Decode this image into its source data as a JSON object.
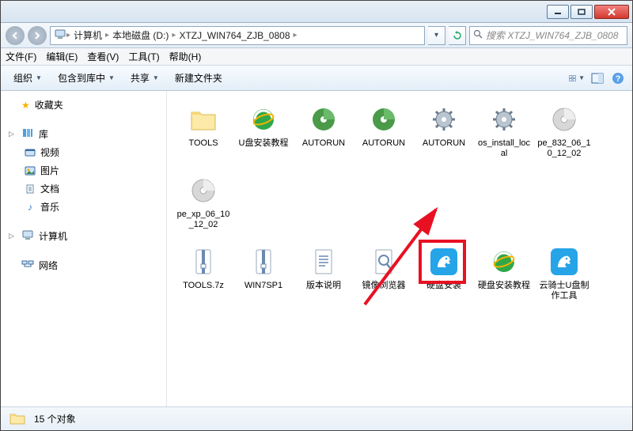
{
  "breadcrumb": {
    "root_icon": "computer-icon",
    "segments": [
      "计算机",
      "本地磁盘 (D:)",
      "XTZJ_WIN764_ZJB_0808"
    ]
  },
  "search": {
    "placeholder": "搜索 XTZJ_WIN764_ZJB_0808"
  },
  "menubar": {
    "file": "文件(F)",
    "edit": "编辑(E)",
    "view": "查看(V)",
    "tools": "工具(T)",
    "help": "帮助(H)"
  },
  "toolbar": {
    "organize": "组织",
    "include": "包含到库中",
    "share": "共享",
    "new_folder": "新建文件夹"
  },
  "sidebar": {
    "favorites": {
      "label": "收藏夹"
    },
    "libraries": {
      "label": "库",
      "items": [
        "视频",
        "图片",
        "文档",
        "音乐"
      ]
    },
    "computer": {
      "label": "计算机"
    },
    "network": {
      "label": "网络"
    }
  },
  "files": {
    "row1": [
      {
        "name": "TOOLS",
        "icon": "folder"
      },
      {
        "name": "U盘安装教程",
        "icon": "ie"
      },
      {
        "name": "AUTORUN",
        "icon": "disc-green"
      },
      {
        "name": "AUTORUN",
        "icon": "disc-green"
      },
      {
        "name": "AUTORUN",
        "icon": "gear"
      },
      {
        "name": "os_install_local",
        "icon": "gear"
      },
      {
        "name": "pe_832_06_10_12_02",
        "icon": "disc-grey"
      },
      {
        "name": "pe_xp_06_10_12_02",
        "icon": "disc-grey"
      }
    ],
    "row2": [
      {
        "name": "TOOLS.7z",
        "icon": "archive"
      },
      {
        "name": "WIN7SP1",
        "icon": "archive"
      },
      {
        "name": "版本说明",
        "icon": "text"
      },
      {
        "name": "镜像浏览器",
        "icon": "magnifier"
      },
      {
        "name": "硬盘安装",
        "icon": "knight",
        "highlight": true
      },
      {
        "name": "硬盘安装教程",
        "icon": "ie"
      },
      {
        "name": "云骑士U盘制作工具",
        "icon": "knight"
      }
    ]
  },
  "statusbar": {
    "count": "15 个对象"
  }
}
